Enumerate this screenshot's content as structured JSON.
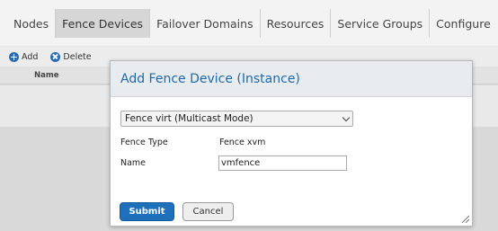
{
  "nav": {
    "tabs": [
      {
        "label": "Nodes",
        "active": false
      },
      {
        "label": "Fence Devices",
        "active": true
      },
      {
        "label": "Failover Domains",
        "active": false
      },
      {
        "label": "Resources",
        "active": false
      },
      {
        "label": "Service Groups",
        "active": false
      },
      {
        "label": "Configure",
        "active": false
      }
    ]
  },
  "toolbar": {
    "add_label": "Add",
    "delete_label": "Delete"
  },
  "table": {
    "name_header": "Name"
  },
  "modal": {
    "title": "Add Fence Device (Instance)",
    "device_select": "Fence virt (Multicast Mode)",
    "fence_type_label": "Fence Type",
    "fence_type_value": "Fence xvm",
    "name_label": "Name",
    "name_value": "vmfence",
    "submit_label": "Submit",
    "cancel_label": "Cancel"
  },
  "colors": {
    "accent": "#1f70bb",
    "title": "#1e6aa8"
  },
  "icons": {
    "add": "plus-circle-icon",
    "delete": "x-circle-icon",
    "select": "chevron-down-icon",
    "resize": "resize-grip-icon"
  }
}
